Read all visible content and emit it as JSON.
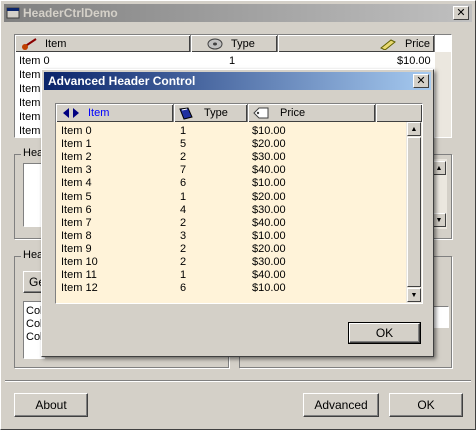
{
  "main_window": {
    "title": "HeaderCtrlDemo",
    "close_glyph": "✕",
    "list": {
      "columns": [
        {
          "label": "Item",
          "icon": "guitar-icon"
        },
        {
          "label": "Type",
          "icon": "disc-icon"
        },
        {
          "label": "Price",
          "icon": "pencil-icon"
        }
      ],
      "first_row": {
        "item": "Item 0",
        "type": "1",
        "price": "$10.00"
      },
      "partial_rows": [
        "Item",
        "Item",
        "Item",
        "Item",
        "Item"
      ]
    },
    "group1_label": "Hea",
    "group2_label": "Hea",
    "group2_button_label": "Ge",
    "group2_list_items": [
      "Col",
      "Col",
      "Col"
    ],
    "buttons": {
      "about": "About",
      "advanced": "Advanced",
      "ok": "OK"
    }
  },
  "dialog": {
    "title": "Advanced Header Control",
    "close_glyph": "✕",
    "columns": [
      {
        "label": "Item",
        "icon": "diamond-arrows-icon",
        "color": "#0000ff"
      },
      {
        "label": "Type",
        "icon": "book-icon",
        "color": "#000000"
      },
      {
        "label": "Price",
        "icon": "tag-icon",
        "color": "#000000"
      }
    ],
    "rows": [
      {
        "item": "Item 0",
        "type": "1",
        "price": "$10.00"
      },
      {
        "item": "Item 1",
        "type": "5",
        "price": "$20.00"
      },
      {
        "item": "Item 2",
        "type": "2",
        "price": "$30.00"
      },
      {
        "item": "Item 3",
        "type": "7",
        "price": "$40.00"
      },
      {
        "item": "Item 4",
        "type": "6",
        "price": "$10.00"
      },
      {
        "item": "Item 5",
        "type": "1",
        "price": "$20.00"
      },
      {
        "item": "Item 6",
        "type": "4",
        "price": "$30.00"
      },
      {
        "item": "Item 7",
        "type": "2",
        "price": "$40.00"
      },
      {
        "item": "Item 8",
        "type": "3",
        "price": "$10.00"
      },
      {
        "item": "Item 9",
        "type": "2",
        "price": "$20.00"
      },
      {
        "item": "Item 10",
        "type": "2",
        "price": "$30.00"
      },
      {
        "item": "Item 11",
        "type": "1",
        "price": "$40.00"
      },
      {
        "item": "Item 12",
        "type": "6",
        "price": "$10.00"
      }
    ],
    "ok_label": "OK"
  },
  "colors": {
    "dialog_list_bg": "#fff3d9",
    "list_bg": "#ffffff",
    "face": "#d4d0c8",
    "title_active_start": "#0a246a",
    "title_active_end": "#a6caf0",
    "title_inactive_start": "#808080",
    "title_inactive_end": "#c0c0c0"
  }
}
